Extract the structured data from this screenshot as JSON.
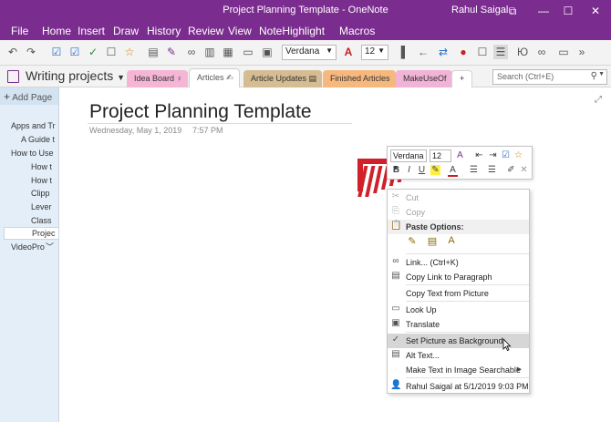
{
  "window": {
    "title": "Project Planning Template - OneNote",
    "user": "Rahul Saigal",
    "controls": [
      "⧉",
      "—",
      "☐",
      "✕"
    ]
  },
  "menu": [
    "File",
    "Home",
    "Insert",
    "Draw",
    "History",
    "Review",
    "View",
    "NoteHighlight",
    "Macros"
  ],
  "ribbon": {
    "font_name": "Verdana",
    "font_size": "12"
  },
  "notebook": {
    "name": "Writing projects",
    "sections": [
      {
        "label": "Idea Board",
        "color": "#f5b6d5"
      },
      {
        "label": "Articles",
        "color": "#ffffff"
      },
      {
        "label": "Article Updates",
        "color": "#d5bc93"
      },
      {
        "label": "Finished Articles",
        "color": "#f7b87e"
      },
      {
        "label": "MakeUseOf",
        "color": "#f1b3d6"
      },
      {
        "label": "+",
        "color": "#ffffff"
      }
    ],
    "search_placeholder": "Search (Ctrl+E)"
  },
  "pages": {
    "add_label": "Add Page",
    "items": [
      "Apps and Tr",
      "A Guide t",
      "How to Use",
      "How t",
      "How t",
      "Clipp",
      "Lever",
      "Class",
      "Projec",
      "VideoPro"
    ]
  },
  "page": {
    "title": "Project Planning Template",
    "date": "Wednesday, May 1, 2019",
    "time": "7:57 PM"
  },
  "mini_toolbar": {
    "font": "Verdana",
    "size": "12"
  },
  "context_menu": {
    "cut": "Cut",
    "copy": "Copy",
    "paste_options": "Paste Options:",
    "link": "Link...  (Ctrl+K)",
    "copy_link": "Copy Link to Paragraph",
    "copy_text": "Copy Text from Picture",
    "look_up": "Look Up",
    "translate": "Translate",
    "set_background": "Set Picture as Background",
    "alt_text": "Alt Text...",
    "make_searchable": "Make Text in Image Searchable",
    "author": "Rahul Saigal at 5/1/2019 9:03 PM"
  }
}
